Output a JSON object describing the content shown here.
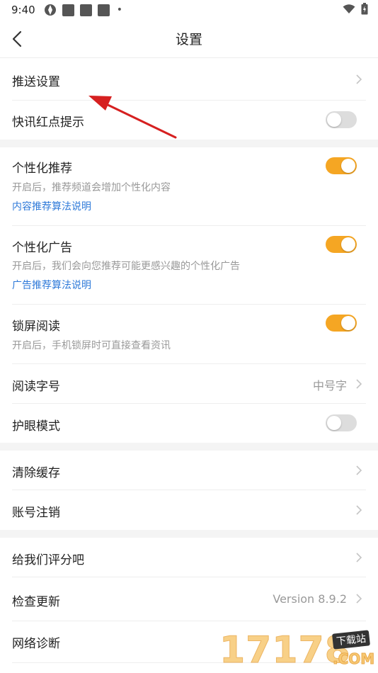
{
  "status_bar": {
    "time": "9:40",
    "dot": "•"
  },
  "nav": {
    "title": "设置"
  },
  "sections": {
    "push_settings": {
      "label": "推送设置"
    },
    "flash_red_dot": {
      "label": "快讯红点提示",
      "enabled": false
    },
    "personal_recommend": {
      "label": "个性化推荐",
      "desc": "开启后，推荐频道会增加个性化内容",
      "link": "内容推荐算法说明",
      "enabled": true
    },
    "personal_ads": {
      "label": "个性化广告",
      "desc": "开启后，我们会向您推荐可能更感兴趣的个性化广告",
      "link": "广告推荐算法说明",
      "enabled": true
    },
    "lock_screen_read": {
      "label": "锁屏阅读",
      "desc": "开启后，手机锁屏时可直接查看资讯",
      "enabled": true
    },
    "font_size": {
      "label": "阅读字号",
      "value": "中号字"
    },
    "eye_care": {
      "label": "护眼模式",
      "enabled": false
    },
    "clear_cache": {
      "label": "清除缓存"
    },
    "account_cancel": {
      "label": "账号注销"
    },
    "rate_us": {
      "label": "给我们评分吧"
    },
    "check_update": {
      "label": "检查更新",
      "value": "Version 8.9.2"
    },
    "network_diag": {
      "label": "网络诊断"
    }
  },
  "watermark": {
    "digits": "17178",
    "tag": "下载站",
    "suffix": ".COM"
  },
  "colors": {
    "accent": "#f5a623",
    "link": "#2f7ad9",
    "annotation_arrow": "#d62020"
  }
}
